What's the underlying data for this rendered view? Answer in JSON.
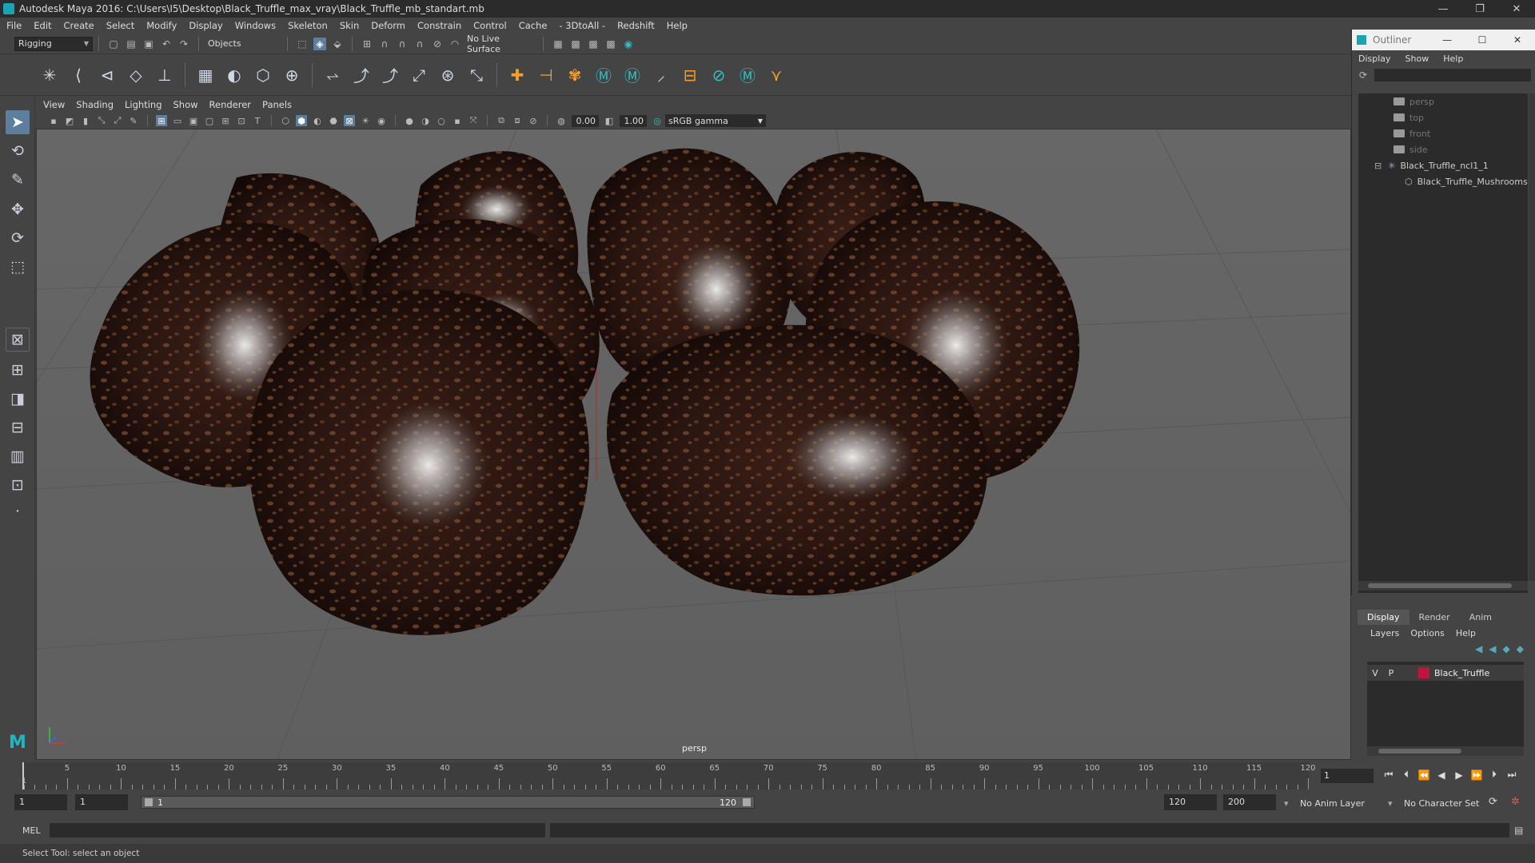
{
  "window": {
    "title": "Autodesk Maya 2016: C:\\Users\\I5\\Desktop\\Black_Truffle_max_vray\\Black_Truffle_mb_standart.mb",
    "controls": [
      "—",
      "❐",
      "✕"
    ]
  },
  "menubar": [
    "File",
    "Edit",
    "Create",
    "Select",
    "Modify",
    "Display",
    "Windows",
    "Skeleton",
    "Skin",
    "Deform",
    "Constrain",
    "Control",
    "Cache",
    "- 3DtoAll -",
    "Redshift",
    "Help"
  ],
  "statusline": {
    "menuset": "Rigging",
    "selection_mode": "Objects",
    "live_surface": "No Live Surface"
  },
  "viewport": {
    "menus": [
      "View",
      "Shading",
      "Lighting",
      "Show",
      "Renderer",
      "Panels"
    ],
    "exposure": "0.00",
    "gamma_value": "1.00",
    "color_space": "sRGB gamma",
    "camera_label": "persp"
  },
  "outliner": {
    "title": "Outliner",
    "menus": [
      "Display",
      "Show",
      "Help"
    ],
    "items": [
      {
        "label": "persp",
        "dim": true
      },
      {
        "label": "top",
        "dim": true
      },
      {
        "label": "front",
        "dim": true
      },
      {
        "label": "side",
        "dim": true
      },
      {
        "label": "Black_Truffle_ncl1_1",
        "dim": false
      },
      {
        "label": "Black_Truffle_Mushrooms",
        "dim": false
      }
    ]
  },
  "layer_editor": {
    "tabs": [
      "Display",
      "Render",
      "Anim"
    ],
    "active_tab": "Display",
    "menus": [
      "Layers",
      "Options",
      "Help"
    ],
    "layer": {
      "visible": "V",
      "playback": "P",
      "name": "Black_Truffle",
      "color": "#c0143c"
    }
  },
  "timeline": {
    "ticks": [
      "5",
      "10",
      "15",
      "20",
      "25",
      "30",
      "35",
      "40",
      "45",
      "50",
      "55",
      "60",
      "65",
      "70",
      "75",
      "80",
      "85",
      "90",
      "95",
      "100",
      "105",
      "110",
      "115",
      "120"
    ],
    "start_mark": "1",
    "current_frame": "1"
  },
  "range": {
    "start": "1",
    "playback_start": "1",
    "slider_start": "1",
    "slider_end": "120",
    "playback_end": "120",
    "end": "200",
    "anim_layer": "No Anim Layer",
    "character_set": "No Character Set"
  },
  "command_line": {
    "label": "MEL",
    "help_text": "Select Tool: select an object"
  }
}
